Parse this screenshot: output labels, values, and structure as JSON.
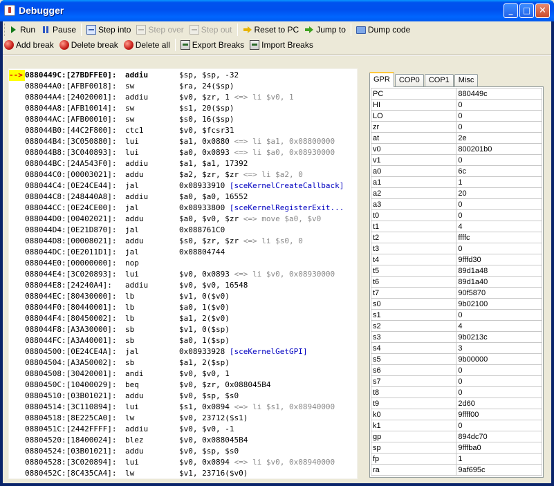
{
  "window": {
    "title": "Debugger",
    "controls": {
      "minimize": "_",
      "maximize": "□",
      "close": "✕"
    }
  },
  "toolbar1": [
    {
      "label": "Run",
      "icon": "play-icon",
      "enabled": true
    },
    {
      "label": "Pause",
      "icon": "pause-icon",
      "enabled": true
    },
    {
      "label": "Step into",
      "icon": "step-into-icon",
      "enabled": true
    },
    {
      "label": "Step over",
      "icon": "step-over-icon",
      "enabled": false
    },
    {
      "label": "Step out",
      "icon": "step-out-icon",
      "enabled": false
    },
    {
      "label": "Reset to PC",
      "icon": "reset-arrow-icon",
      "enabled": true
    },
    {
      "label": "Jump to",
      "icon": "jump-arrow-icon",
      "enabled": true
    },
    {
      "label": "Dump code",
      "icon": "dump-monitor-icon",
      "enabled": true
    }
  ],
  "toolbar2": [
    {
      "label": "Add break",
      "icon": "red-ball-icon"
    },
    {
      "label": "Delete break",
      "icon": "red-ball-icon"
    },
    {
      "label": "Delete all",
      "icon": "red-ball-pin-icon"
    },
    {
      "label": "Export Breaks",
      "icon": "book-export-icon"
    },
    {
      "label": "Import Breaks",
      "icon": "book-import-icon"
    }
  ],
  "disassembly": {
    "pc_marker": "-->",
    "lines": [
      {
        "addr": "0880449C:[27BDFFE0]:",
        "mnem": "addiu",
        "ops": "$sp, $sp, -32",
        "comment": "",
        "symbol": ""
      },
      {
        "addr": "088044A0:[AFBF0018]:",
        "mnem": "sw",
        "ops": "$ra, 24($sp)",
        "comment": "",
        "symbol": ""
      },
      {
        "addr": "088044A4:[24020001]:",
        "mnem": "addiu",
        "ops": "$v0, $zr, 1 ",
        "comment": "<=> li $v0, 1",
        "symbol": ""
      },
      {
        "addr": "088044A8:[AFB10014]:",
        "mnem": "sw",
        "ops": "$s1, 20($sp)",
        "comment": "",
        "symbol": ""
      },
      {
        "addr": "088044AC:[AFB00010]:",
        "mnem": "sw",
        "ops": "$s0, 16($sp)",
        "comment": "",
        "symbol": ""
      },
      {
        "addr": "088044B0:[44C2F800]:",
        "mnem": "ctc1",
        "ops": "$v0, $fcsr31",
        "comment": "",
        "symbol": ""
      },
      {
        "addr": "088044B4:[3C050880]:",
        "mnem": "lui",
        "ops": "$a1, 0x0880 ",
        "comment": "<=> li $a1, 0x08800000",
        "symbol": ""
      },
      {
        "addr": "088044B8:[3C040893]:",
        "mnem": "lui",
        "ops": "$a0, 0x0893 ",
        "comment": "<=> li $a0, 0x08930000",
        "symbol": ""
      },
      {
        "addr": "088044BC:[24A543F0]:",
        "mnem": "addiu",
        "ops": "$a1, $a1, 17392",
        "comment": "",
        "symbol": ""
      },
      {
        "addr": "088044C0:[00003021]:",
        "mnem": "addu",
        "ops": "$a2, $zr, $zr ",
        "comment": "<=> li $a2, 0",
        "symbol": ""
      },
      {
        "addr": "088044C4:[0E24CE44]:",
        "mnem": "jal",
        "ops": "0x08933910 ",
        "comment": "",
        "symbol": "[sceKernelCreateCallback]"
      },
      {
        "addr": "088044C8:[248440A8]:",
        "mnem": "addiu",
        "ops": "$a0, $a0, 16552",
        "comment": "",
        "symbol": ""
      },
      {
        "addr": "088044CC:[0E24CE00]:",
        "mnem": "jal",
        "ops": "0x08933800 ",
        "comment": "",
        "symbol": "[sceKernelRegisterExit..."
      },
      {
        "addr": "088044D0:[00402021]:",
        "mnem": "addu",
        "ops": "$a0, $v0, $zr ",
        "comment": "<=> move $a0, $v0",
        "symbol": ""
      },
      {
        "addr": "088044D4:[0E21D870]:",
        "mnem": "jal",
        "ops": "0x088761C0",
        "comment": "",
        "symbol": ""
      },
      {
        "addr": "088044D8:[00008021]:",
        "mnem": "addu",
        "ops": "$s0, $zr, $zr ",
        "comment": "<=> li $s0, 0",
        "symbol": ""
      },
      {
        "addr": "088044DC:[0E2011D1]:",
        "mnem": "jal",
        "ops": "0x08804744",
        "comment": "",
        "symbol": ""
      },
      {
        "addr": "088044E0:[00000000]:",
        "mnem": "nop",
        "ops": "",
        "comment": "",
        "symbol": ""
      },
      {
        "addr": "088044E4:[3C020893]:",
        "mnem": "lui",
        "ops": "$v0, 0x0893 ",
        "comment": "<=> li $v0, 0x08930000",
        "symbol": ""
      },
      {
        "addr": "088044E8:[24240A4]:",
        "mnem": "addiu",
        "ops": "$v0, $v0, 16548",
        "comment": "",
        "symbol": ""
      },
      {
        "addr": "088044EC:[80430000]:",
        "mnem": "lb",
        "ops": "$v1, 0($v0)",
        "comment": "",
        "symbol": ""
      },
      {
        "addr": "088044F0:[80440001]:",
        "mnem": "lb",
        "ops": "$a0, 1($v0)",
        "comment": "",
        "symbol": ""
      },
      {
        "addr": "088044F4:[80450002]:",
        "mnem": "lb",
        "ops": "$a1, 2($v0)",
        "comment": "",
        "symbol": ""
      },
      {
        "addr": "088044F8:[A3A30000]:",
        "mnem": "sb",
        "ops": "$v1, 0($sp)",
        "comment": "",
        "symbol": ""
      },
      {
        "addr": "088044FC:[A3A40001]:",
        "mnem": "sb",
        "ops": "$a0, 1($sp)",
        "comment": "",
        "symbol": ""
      },
      {
        "addr": "08804500:[0E24CE4A]:",
        "mnem": "jal",
        "ops": "0x08933928 ",
        "comment": "",
        "symbol": "[sceKernelGetGPI]"
      },
      {
        "addr": "08804504:[A3A50002]:",
        "mnem": "sb",
        "ops": "$a1, 2($sp)",
        "comment": "",
        "symbol": ""
      },
      {
        "addr": "08804508:[30420001]:",
        "mnem": "andi",
        "ops": "$v0, $v0, 1",
        "comment": "",
        "symbol": ""
      },
      {
        "addr": "0880450C:[10400029]:",
        "mnem": "beq",
        "ops": "$v0, $zr, 0x088045B4",
        "comment": "",
        "symbol": ""
      },
      {
        "addr": "08804510:[03B01021]:",
        "mnem": "addu",
        "ops": "$v0, $sp, $s0",
        "comment": "",
        "symbol": ""
      },
      {
        "addr": "08804514:[3C110894]:",
        "mnem": "lui",
        "ops": "$s1, 0x0894 ",
        "comment": "<=> li $s1, 0x08940000",
        "symbol": ""
      },
      {
        "addr": "08804518:[8E225CA0]:",
        "mnem": "lw",
        "ops": "$v0, 23712($s1)",
        "comment": "",
        "symbol": ""
      },
      {
        "addr": "0880451C:[2442FFFF]:",
        "mnem": "addiu",
        "ops": "$v0, $v0, -1",
        "comment": "",
        "symbol": ""
      },
      {
        "addr": "08804520:[18400024]:",
        "mnem": "blez",
        "ops": "$v0, 0x088045B4",
        "comment": "",
        "symbol": ""
      },
      {
        "addr": "08804524:[03B01021]:",
        "mnem": "addu",
        "ops": "$v0, $sp, $s0",
        "comment": "",
        "symbol": ""
      },
      {
        "addr": "08804528:[3C020894]:",
        "mnem": "lui",
        "ops": "$v0, 0x0894 ",
        "comment": "<=> li $v0, 0x08940000",
        "symbol": ""
      },
      {
        "addr": "0880452C:[8C435CA4]:",
        "mnem": "lw",
        "ops": "$v1, 23716($v0)",
        "comment": "",
        "symbol": ""
      }
    ]
  },
  "registers": {
    "tabs": [
      "GPR",
      "COP0",
      "COP1",
      "Misc"
    ],
    "active_tab": "GPR",
    "rows": [
      {
        "name": "PC",
        "value": "880449c"
      },
      {
        "name": "HI",
        "value": "0"
      },
      {
        "name": "LO",
        "value": "0"
      },
      {
        "name": "zr",
        "value": "0"
      },
      {
        "name": "at",
        "value": "2e"
      },
      {
        "name": "v0",
        "value": "800201b0"
      },
      {
        "name": "v1",
        "value": "0"
      },
      {
        "name": "a0",
        "value": "6c"
      },
      {
        "name": "a1",
        "value": "1"
      },
      {
        "name": "a2",
        "value": "20"
      },
      {
        "name": "a3",
        "value": "0"
      },
      {
        "name": "t0",
        "value": "0"
      },
      {
        "name": "t1",
        "value": "4"
      },
      {
        "name": "t2",
        "value": "ffffc"
      },
      {
        "name": "t3",
        "value": "0"
      },
      {
        "name": "t4",
        "value": "9fffd30"
      },
      {
        "name": "t5",
        "value": "89d1a48"
      },
      {
        "name": "t6",
        "value": "89d1a40"
      },
      {
        "name": "t7",
        "value": "90f5870"
      },
      {
        "name": "s0",
        "value": "9b02100"
      },
      {
        "name": "s1",
        "value": "0"
      },
      {
        "name": "s2",
        "value": "4"
      },
      {
        "name": "s3",
        "value": "9b0213c"
      },
      {
        "name": "s4",
        "value": "3"
      },
      {
        "name": "s5",
        "value": "9b00000"
      },
      {
        "name": "s6",
        "value": "0"
      },
      {
        "name": "s7",
        "value": "0"
      },
      {
        "name": "t8",
        "value": "0"
      },
      {
        "name": "t9",
        "value": "2d60"
      },
      {
        "name": "k0",
        "value": "9ffff00"
      },
      {
        "name": "k1",
        "value": "0"
      },
      {
        "name": "gp",
        "value": "894dc70"
      },
      {
        "name": "sp",
        "value": "9fffba0"
      },
      {
        "name": "fp",
        "value": "1"
      },
      {
        "name": "ra",
        "value": "9af695c"
      }
    ]
  },
  "colors": {
    "pc_marker_bg": "#ffff00",
    "pc_marker_fg": "#dd0000",
    "comment": "#888888",
    "symbol": "#0000c0",
    "active_tab_accent": "#ffc83c"
  }
}
